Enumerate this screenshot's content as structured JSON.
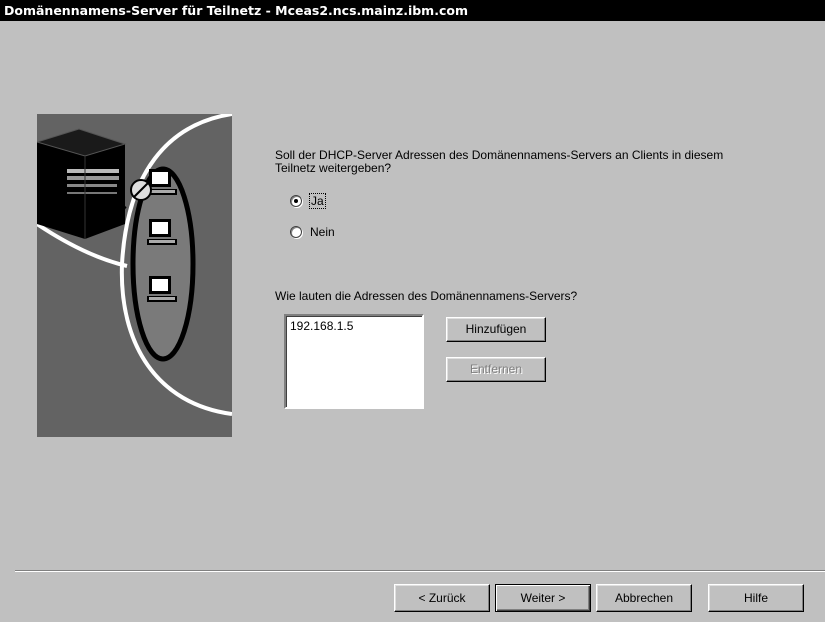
{
  "window": {
    "title": "Domänennamens-Server für Teilnetz - Mceas2.ncs.mainz.ibm.com"
  },
  "question": {
    "text": "Soll der DHCP-Server Adressen des Domänennamens-Servers an Clients in diesem Teilnetz weitergeben?"
  },
  "radios": {
    "yes": {
      "label": "Ja",
      "checked": true
    },
    "no": {
      "label": "Nein",
      "checked": false
    }
  },
  "addresses": {
    "label": "Wie lauten die Adressen des Domänennamens-Servers?",
    "items": [
      "192.168.1.5"
    ]
  },
  "buttons": {
    "add": "Hinzufügen",
    "remove": "Entfernen",
    "back": "< Zurück",
    "next": "Weiter >",
    "cancel": "Abbrechen",
    "help": "Hilfe"
  },
  "colors": {
    "dialog_bg": "#c0c0c0",
    "titlebar_bg": "#000000",
    "illustration_bg": "#636363"
  },
  "icons": [
    "server-icon",
    "computer-icon",
    "magnifier-icon"
  ]
}
